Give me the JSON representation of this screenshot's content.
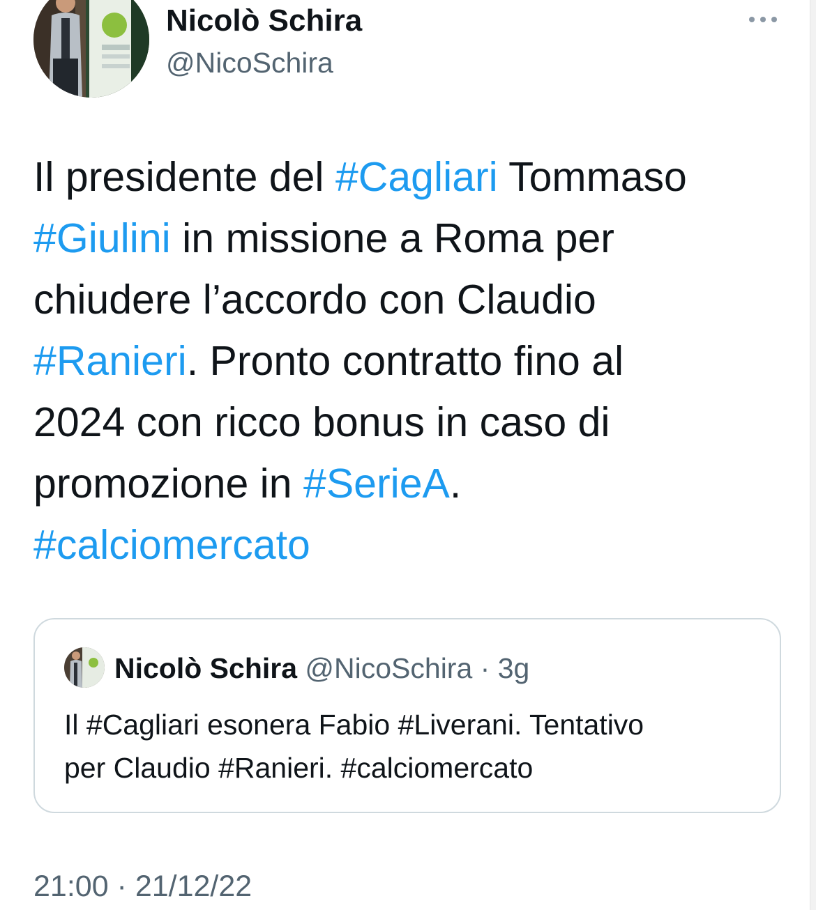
{
  "author": {
    "display_name": "Nicolò Schira",
    "handle": "@NicoSchira"
  },
  "more_menu_icon": "more-horizontal-icon",
  "tweet": {
    "lines": [
      [
        {
          "t": "Il presidente del "
        },
        {
          "t": "#Cagliari",
          "tag": true
        },
        {
          "t": " Tommaso"
        }
      ],
      [
        {
          "t": "#Giulini",
          "tag": true
        },
        {
          "t": " in missione a Roma per"
        }
      ],
      [
        {
          "t": "chiudere l’accordo con Claudio"
        }
      ],
      [
        {
          "t": "#Ranieri",
          "tag": true
        },
        {
          "t": ". Pronto contratto fino al"
        }
      ],
      [
        {
          "t": "2024 con ricco bonus in caso di"
        }
      ],
      [
        {
          "t": "promozione in "
        },
        {
          "t": "#SerieA",
          "tag": true
        },
        {
          "t": "."
        }
      ],
      [
        {
          "t": "#calciomercato",
          "tag": true
        }
      ]
    ]
  },
  "quoted_tweet": {
    "display_name": "Nicolò Schira",
    "meta": " @NicoSchira · 3g",
    "lines": [
      "Il #Cagliari esonera Fabio #Liverani. Tentativo",
      "per Claudio #Ranieri. #calciomercato"
    ]
  },
  "timestamp": "21:00 · 21/12/22",
  "colors": {
    "hashtag": "#1d9bf0",
    "text": "#0f1419",
    "secondary": "#536471",
    "border": "#cfd9de"
  }
}
